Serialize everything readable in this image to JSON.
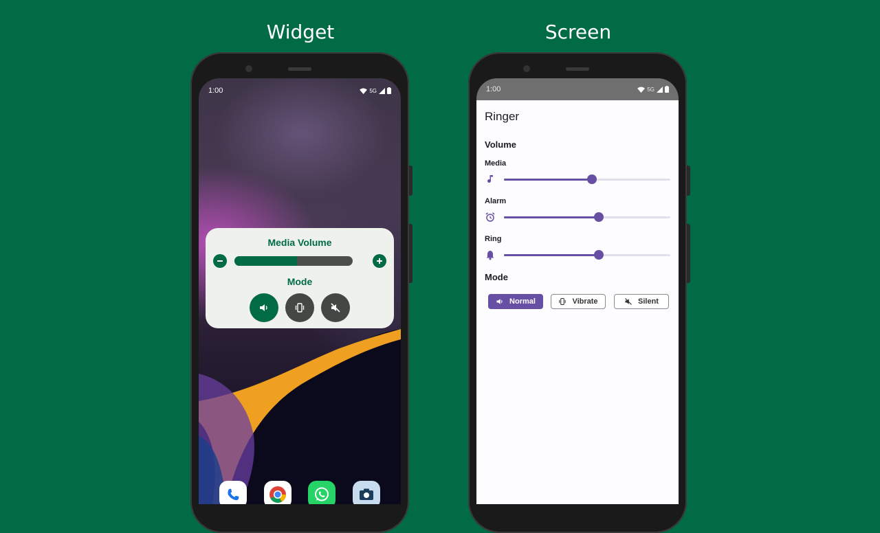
{
  "captions": {
    "left": "Widget",
    "right": "Screen"
  },
  "widget_phone": {
    "status_time": "1:00",
    "status_network": "5G",
    "widget": {
      "title": "Media Volume",
      "volume_level": 0.53,
      "minus_icon": "minus-icon",
      "plus_icon": "plus-icon",
      "mode_title": "Mode",
      "modes": [
        "speaker-icon",
        "vibrate-icon",
        "mute-icon"
      ],
      "active_mode_index": 0
    },
    "dock": [
      "phone-app-icon",
      "chrome-app-icon",
      "whatsapp-app-icon",
      "camera-app-icon"
    ]
  },
  "screen_phone": {
    "status_time": "1:00",
    "status_network": "5G",
    "app_title": "Ringer",
    "volume_section": "Volume",
    "sliders": [
      {
        "label": "Media",
        "icon": "music-note-icon",
        "value": 0.53
      },
      {
        "label": "Alarm",
        "icon": "alarm-icon",
        "value": 0.57
      },
      {
        "label": "Ring",
        "icon": "bell-icon",
        "value": 0.57
      }
    ],
    "mode_section": "Mode",
    "modes": [
      {
        "label": "Normal",
        "icon": "speaker-icon",
        "selected": true
      },
      {
        "label": "Vibrate",
        "icon": "vibrate-icon",
        "selected": false
      },
      {
        "label": "Silent",
        "icon": "mute-icon",
        "selected": false
      }
    ]
  },
  "colors": {
    "background": "#006b45",
    "widget_accent": "#006b45",
    "app_accent": "#6750a4"
  }
}
